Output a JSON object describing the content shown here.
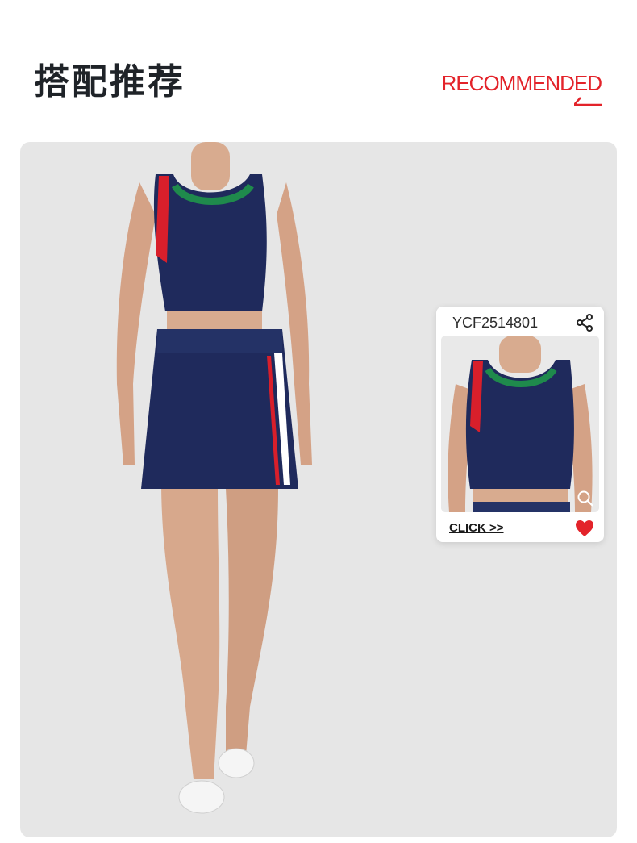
{
  "header": {
    "title_cn": "搭配推荐",
    "title_en": "RECOMMENDED"
  },
  "product_card": {
    "code": "YCF2514801",
    "link_label": "CLICK >>",
    "icons": [
      "share-icon",
      "zoom-icon",
      "heart-icon"
    ]
  },
  "colors": {
    "accent_red": "#e3232a",
    "navy": "#1f2a5c",
    "trim_green": "#1f8a4c",
    "panel_bg": "#e6e6e6"
  }
}
